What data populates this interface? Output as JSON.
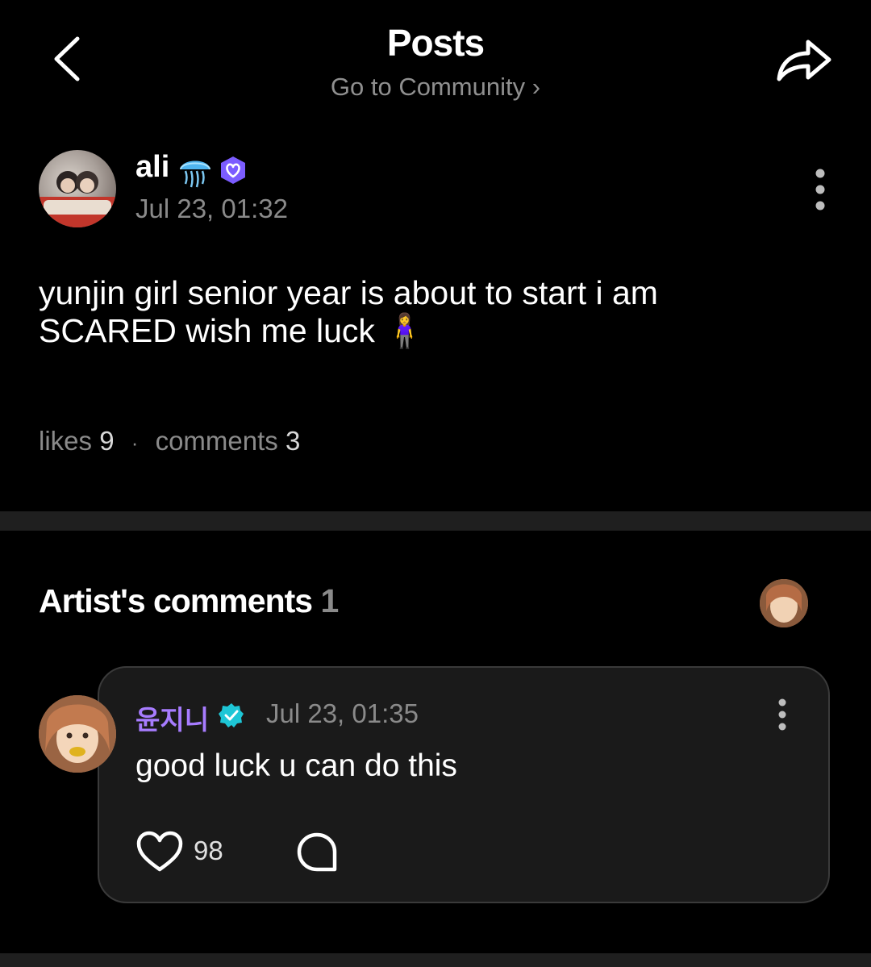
{
  "header": {
    "title": "Posts",
    "community_link": "Go to Community",
    "community_chevron": "›",
    "back_icon": "chevron-left-icon",
    "share_icon": "share-arrow-icon"
  },
  "post": {
    "author": "ali",
    "author_emoji_icon": "jellyfish-icon",
    "badge_icon": "verified-heart-badge-icon",
    "date": "Jul 23, 01:32",
    "text": "yunjin girl senior year is about to start i am SCARED wish me luck 🧍‍♀️",
    "likes_label": "likes",
    "likes": "9",
    "separator": "·",
    "comments_label": "comments",
    "comments": "3"
  },
  "artist_comments": {
    "heading": "Artist's comments",
    "count": "1",
    "comment": {
      "author": "윤지니",
      "date": "Jul 23, 01:35",
      "text": "good luck u can do this",
      "likes": "98"
    }
  },
  "colors": {
    "background": "#000000",
    "accent_purple": "#a77cff",
    "muted_text": "#8a8a8a",
    "card_bg": "#1a1a1a",
    "badge_cyan": "#1ec6d6"
  }
}
